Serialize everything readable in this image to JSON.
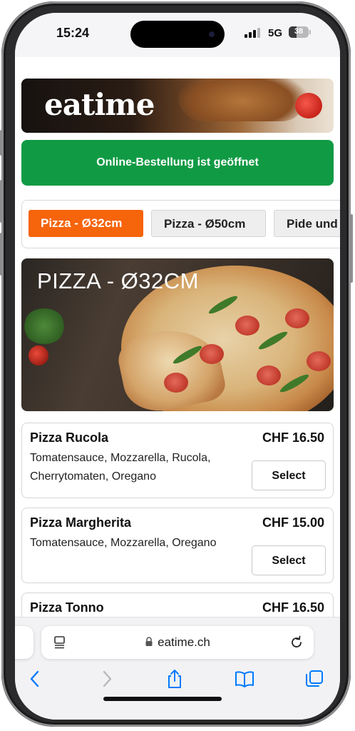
{
  "status_bar": {
    "time": "15:24",
    "network": "5G",
    "battery": "38"
  },
  "banner": {
    "logo": "eatime"
  },
  "ordering_status": {
    "label": "Online-Bestellung ist geöffnet"
  },
  "category_tabs": [
    {
      "label": "Pizza - Ø32cm",
      "active": true
    },
    {
      "label": "Pizza - Ø50cm",
      "active": false
    },
    {
      "label": "Pide und",
      "active": false
    }
  ],
  "category": {
    "title": "PIZZA - Ø32CM"
  },
  "menu_items": [
    {
      "name": "Pizza Rucola",
      "price": "CHF 16.50",
      "description": "Tomatensauce, Mozzarella, Rucola, Cherrytomaten, Oregano",
      "button": "Select"
    },
    {
      "name": "Pizza Margherita",
      "price": "CHF 15.00",
      "description": "Tomatensauce, Mozzarella, Oregano",
      "button": "Select"
    },
    {
      "name": "Pizza Tonno",
      "price": "CHF 16.50"
    }
  ],
  "browser": {
    "url": "eatime.ch"
  },
  "colors": {
    "accent_green": "#119a44",
    "active_tab_orange": "#f6640c",
    "ios_blue": "#007aff"
  },
  "icons": [
    "back-arrow-icon",
    "forward-arrow-icon",
    "share-icon",
    "bookmarks-icon",
    "tabs-icon",
    "reload-icon",
    "lock-icon",
    "tab-overview-icon"
  ]
}
